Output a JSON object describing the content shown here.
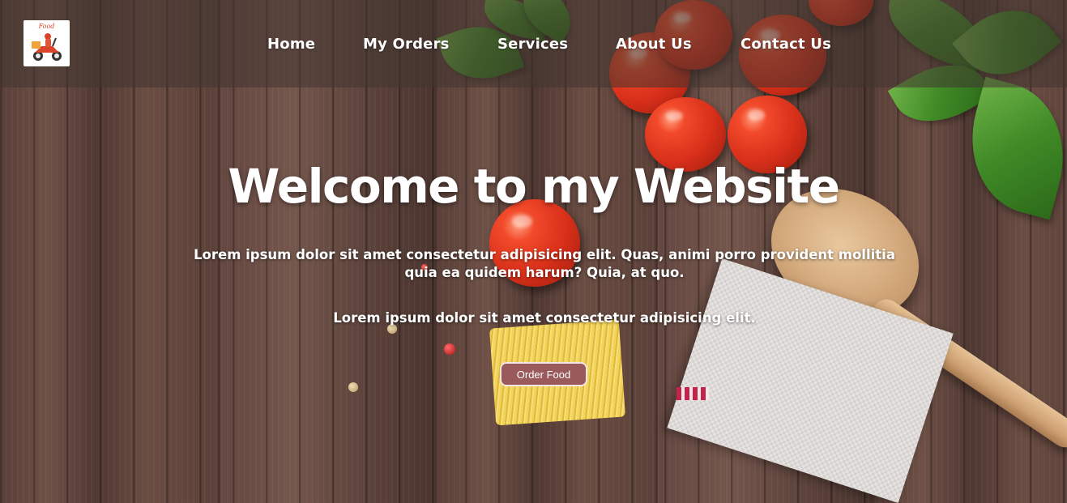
{
  "logo": {
    "alt": "Food delivery scooter logo",
    "script_text": "Food"
  },
  "nav": {
    "items": [
      {
        "label": "Home"
      },
      {
        "label": "My Orders"
      },
      {
        "label": "Services"
      },
      {
        "label": "About Us"
      },
      {
        "label": "Contact Us"
      }
    ]
  },
  "hero": {
    "title": "Welcome to my Website",
    "paragraph1": "Lorem ipsum dolor sit amet consectetur adipisicing elit. Quas, animi porro provident mollitia quia ea quidem harum? Quia, at quo.",
    "paragraph2": "Lorem ipsum dolor sit amet consectetur adipisicing elit.",
    "button_label": "Order Food"
  },
  "colors": {
    "nav_overlay": "#413430",
    "button_bg": "#9a5a5c",
    "button_border": "#f3e6e6",
    "text": "#ffffff"
  }
}
